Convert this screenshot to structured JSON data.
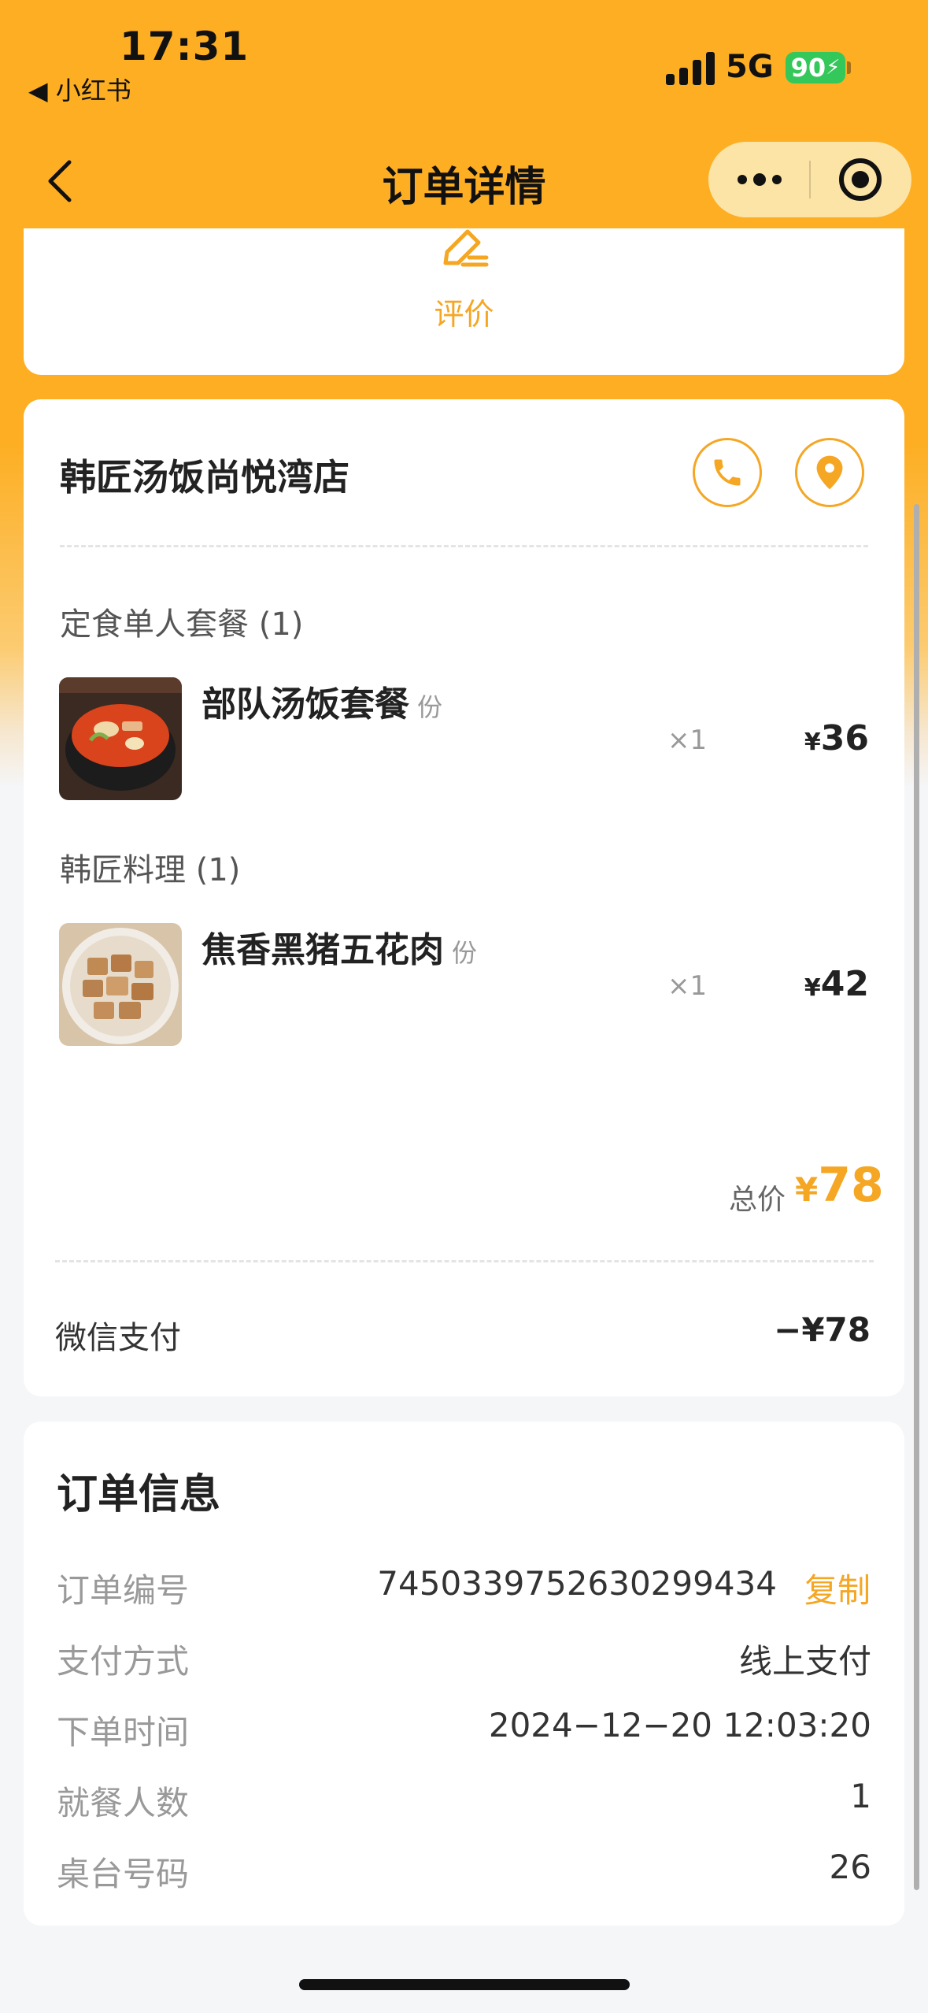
{
  "status_bar": {
    "time": "17:31",
    "back_app": "◀ 小红书",
    "network": "5G",
    "battery": "90"
  },
  "nav": {
    "title": "订单详情"
  },
  "review": {
    "label": "评价"
  },
  "shop": {
    "name": "韩匠汤饭尚悦湾店"
  },
  "order_items": [
    {
      "category": "定食单人套餐 (1)",
      "name": "部队汤饭套餐",
      "unit": "份",
      "qty": "×1",
      "currency": "¥",
      "price": "36"
    },
    {
      "category": "韩匠料理 (1)",
      "name": "焦香黑猪五花肉",
      "unit": "份",
      "qty": "×1",
      "currency": "¥",
      "price": "42"
    }
  ],
  "total": {
    "label": "总价",
    "currency": "¥",
    "value": "78"
  },
  "payment": {
    "label": "微信支付",
    "value": "−¥78"
  },
  "order_info": {
    "title": "订单信息",
    "rows": [
      {
        "key": "订单编号",
        "value": "7450339752630299434",
        "action": "复制"
      },
      {
        "key": "支付方式",
        "value": "线上支付"
      },
      {
        "key": "下单时间",
        "value": "2024−12−20 12:03:20"
      },
      {
        "key": "就餐人数",
        "value": "1"
      },
      {
        "key": "桌台号码",
        "value": "26"
      }
    ]
  },
  "colors": {
    "accent": "#F5A623",
    "header_bg": "#FDAE22",
    "page_bg": "#F5F6F8"
  }
}
